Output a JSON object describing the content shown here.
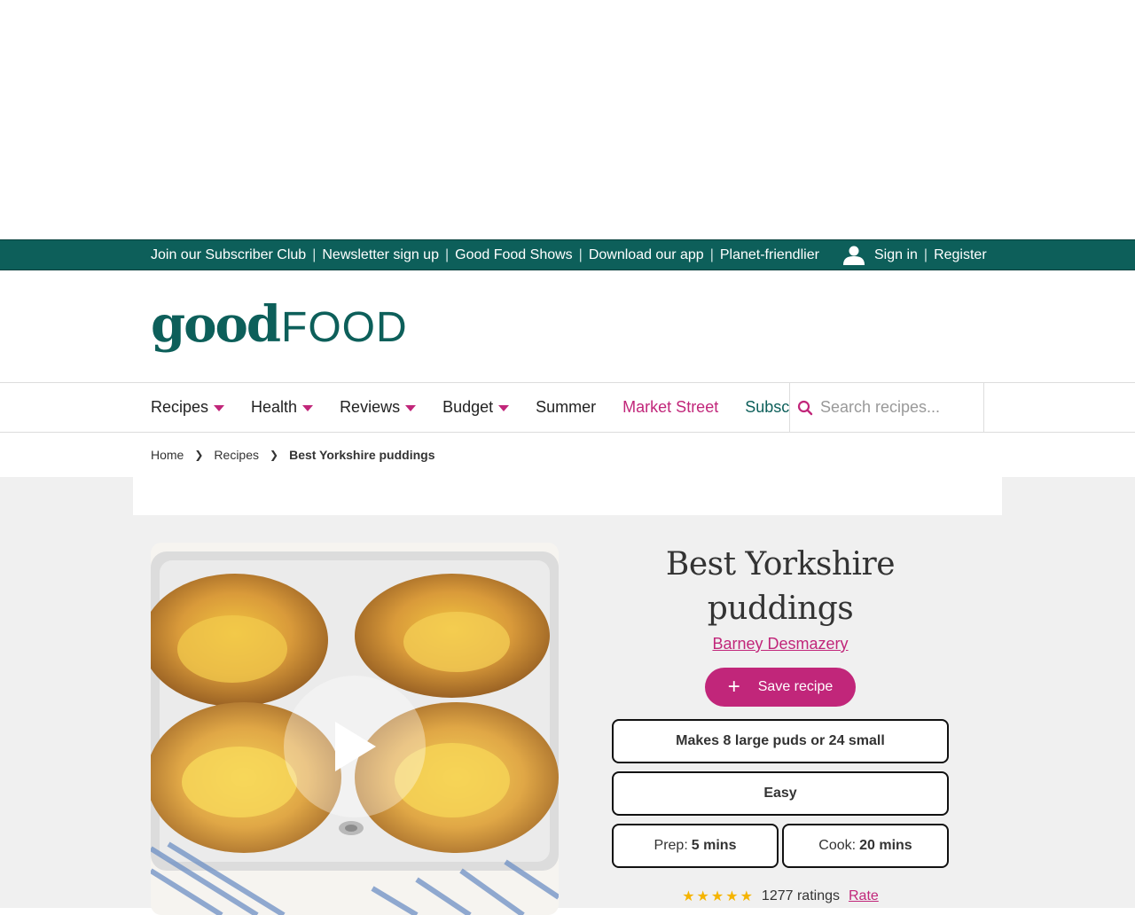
{
  "topbar": {
    "links": [
      "Join our Subscriber Club",
      "Newsletter sign up",
      "Good Food Shows",
      "Download our app",
      "Planet-friendlier"
    ],
    "sign_in": "Sign in",
    "register": "Register"
  },
  "logo": {
    "good": "good",
    "food": "FOOD"
  },
  "nav": {
    "items": [
      {
        "label": "Recipes",
        "dropdown": true
      },
      {
        "label": "Health",
        "dropdown": true
      },
      {
        "label": "Reviews",
        "dropdown": true
      },
      {
        "label": "Budget",
        "dropdown": true
      },
      {
        "label": "Summer",
        "dropdown": false
      },
      {
        "label": "Market Street",
        "dropdown": false
      },
      {
        "label": "Subscribe",
        "dropdown": false
      }
    ],
    "search_placeholder": "Search recipes..."
  },
  "breadcrumb": {
    "home": "Home",
    "recipes": "Recipes",
    "current": "Best Yorkshire puddings"
  },
  "recipe": {
    "title": "Best Yorkshire puddings",
    "author": "Barney Desmazery",
    "save_label": "Save recipe",
    "serves": "Makes 8 large puds or 24 small",
    "difficulty": "Easy",
    "prep_label": "Prep:",
    "prep_value": "5 mins",
    "cook_label": "Cook:",
    "cook_value": "20 mins",
    "stars": "★★★★★",
    "ratings": "1277 ratings",
    "rate_label": "Rate"
  },
  "colors": {
    "brand_teal": "#0d5f5a",
    "accent_magenta": "#c1267a",
    "star": "#f5b400"
  }
}
